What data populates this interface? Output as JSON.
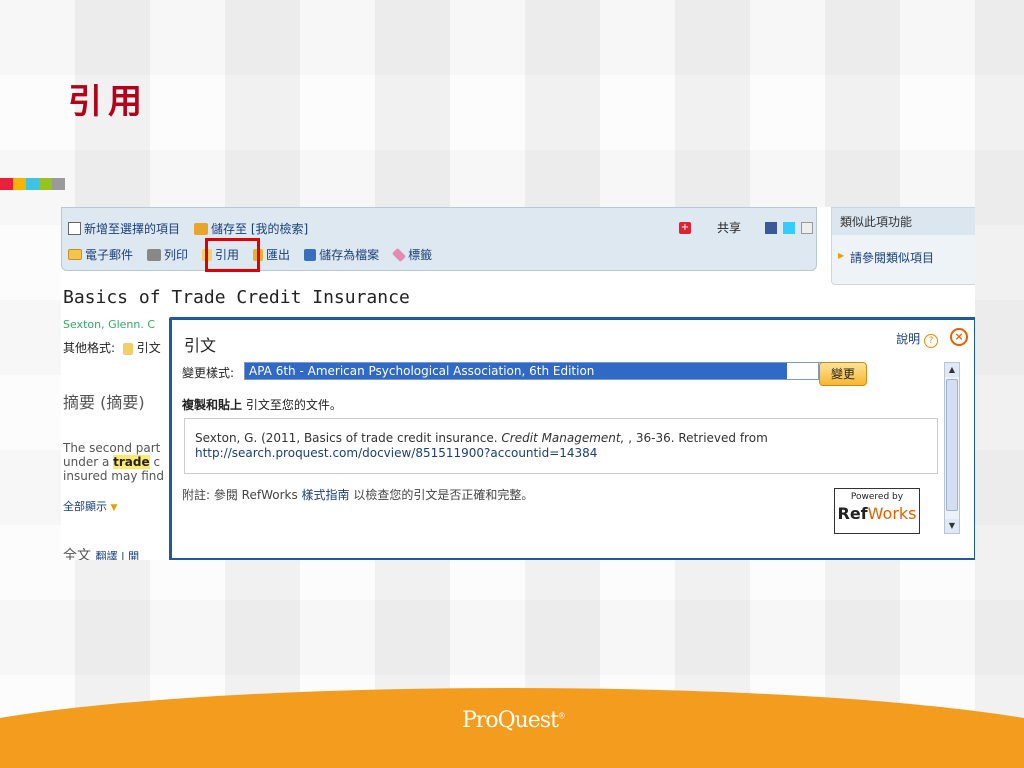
{
  "slide": {
    "title": "引用",
    "color_bar": [
      "#e8203a",
      "#f7b500",
      "#3ec3e6",
      "#97c31e",
      "#9a9a9a"
    ]
  },
  "toolbar": {
    "add_selected": "新增至選擇的項目",
    "save_to": "儲存至 [我的檢索]",
    "share": "共享",
    "email": "電子郵件",
    "print": "列印",
    "cite": "引用",
    "export": "匯出",
    "save_file": "儲存為檔案",
    "tag": "標籤"
  },
  "side_panel": {
    "title": "類似此項功能",
    "link": "請參閱類似項目"
  },
  "article": {
    "title": "Basics of Trade Credit Insurance",
    "author": "Sexton, Glenn. C",
    "other_formats_label": "其他格式:",
    "other_formats_value": "引文",
    "abstract_heading": "摘要 (摘要)",
    "abstract_line1": "The second part",
    "abstract_line2_pre": "under a ",
    "abstract_line2_hl": "trade",
    "abstract_line2_post": " c",
    "abstract_line3": "insured may find",
    "show_all": "全部顯示",
    "fulltext_heading": "全文",
    "fulltext_link": "翻譯 | 開"
  },
  "dialog": {
    "title": "引文",
    "help": "說明",
    "style_label": "變更樣式:",
    "style_value": "APA 6th - American Psychological Association, 6th Edition",
    "change_button": "變更",
    "copy_bold": "複製和貼上",
    "copy_rest": " 引文至您的文件。",
    "citation_text": "Sexton, G. (2011, Basics of trade credit insurance. ",
    "citation_journal": "Credit Management,",
    "citation_rest": " , 36-36. Retrieved from",
    "citation_url": "http://search.proquest.com/docview/851511900?accountid=14384",
    "note_pre": "附註: 參閱 RefWorks ",
    "note_link": "樣式指南",
    "note_post": " 以檢查您的引文是否正確和完整。",
    "refworks_powered": "Powered by",
    "refworks_ref": "Ref",
    "refworks_works": "Works"
  },
  "footer": {
    "logo": "ProQuest",
    "wave_color": "#f39c1e"
  }
}
